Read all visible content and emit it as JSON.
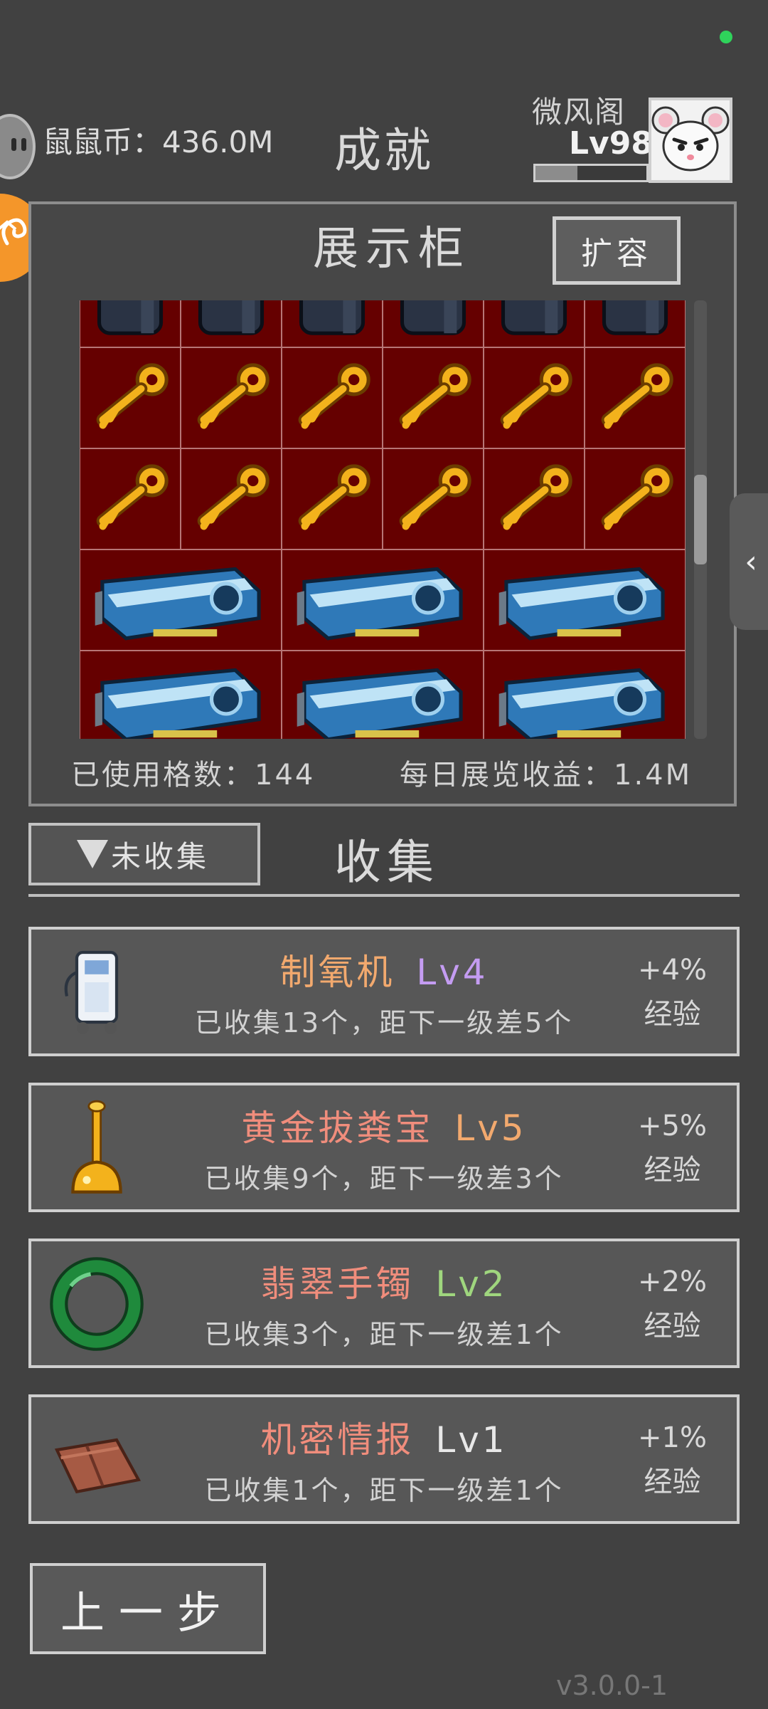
{
  "header": {
    "coin_label": "鼠鼠币：436.0M",
    "page_title": "成就",
    "user_name": "微风阁",
    "user_level": "Lv98",
    "xp_progress": 0.38
  },
  "showcase": {
    "title": "展示柜",
    "expand_label": "扩容",
    "used_slots_text": "已使用格数：144",
    "daily_income_text": "每日展览收益：1.4M",
    "scroll_position": 0.5,
    "rows": [
      {
        "item": "speaker",
        "cols": 6
      },
      {
        "item": "gold-key",
        "cols": 6
      },
      {
        "item": "gold-key",
        "cols": 6
      },
      {
        "item": "graphics-card",
        "cols": 3
      },
      {
        "item": "graphics-card",
        "cols": 3
      }
    ]
  },
  "collection": {
    "filter_label": "未收集",
    "title": "收集",
    "items": [
      {
        "icon": "oxygen-machine-icon",
        "name": "制氧机",
        "name_color": "#f2a96e",
        "level": "Lv4",
        "level_color": "#c49cf2",
        "progress": "已收集13个，距下一级差5个",
        "bonus": "+4%",
        "bonus_label": "经验"
      },
      {
        "icon": "golden-plunger-icon",
        "name": "黄金拔粪宝",
        "name_color": "#f08d7c",
        "level": "Lv5",
        "level_color": "#f2a96e",
        "progress": "已收集9个，距下一级差3个",
        "bonus": "+5%",
        "bonus_label": "经验"
      },
      {
        "icon": "jade-bracelet-icon",
        "name": "翡翠手镯",
        "name_color": "#f08d7c",
        "level": "Lv2",
        "level_color": "#9fd67e",
        "progress": "已收集3个，距下一级差1个",
        "bonus": "+2%",
        "bonus_label": "经验"
      },
      {
        "icon": "secret-intel-icon",
        "name": "机密情报",
        "name_color": "#f08d7c",
        "level": "Lv1",
        "level_color": "#e8e8e8",
        "progress": "已收集1个，距下一级差1个",
        "bonus": "+1%",
        "bonus_label": "经验"
      }
    ]
  },
  "footer": {
    "back_label": "上一步",
    "version": "v3.0.0-1"
  }
}
